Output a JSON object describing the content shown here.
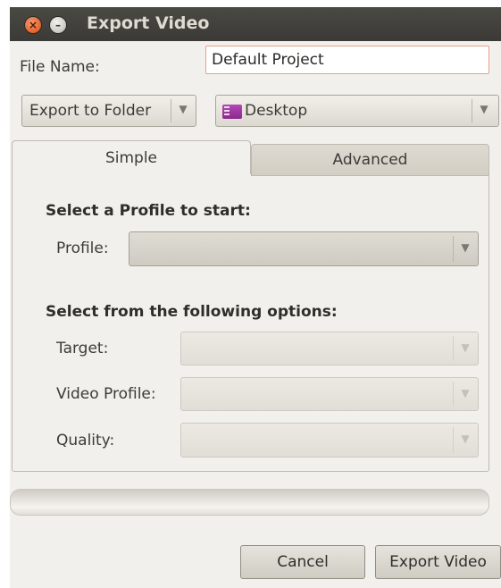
{
  "window": {
    "title": "Export Video"
  },
  "file_name": {
    "label": "File Name:",
    "value": "Default Project"
  },
  "export_mode": {
    "selected": "Export to Folder"
  },
  "folder": {
    "selected": "Desktop",
    "icon": "folder-icon",
    "icon_color": "#9b35a0"
  },
  "tabs": [
    {
      "label": "Simple",
      "active": true
    },
    {
      "label": "Advanced",
      "active": false
    }
  ],
  "simple": {
    "profile_heading": "Select a Profile to start:",
    "profile_label": "Profile:",
    "profile_value": "",
    "options_heading": "Select from the following options:",
    "target_label": "Target:",
    "target_value": "",
    "video_profile_label": "Video Profile:",
    "video_profile_value": "",
    "quality_label": "Quality:",
    "quality_value": ""
  },
  "progress": {
    "fraction": 0
  },
  "buttons": {
    "cancel": "Cancel",
    "export": "Export Video"
  },
  "colors": {
    "titlebar": "#3f3e3a",
    "close_button": "#e65a24",
    "entry_border": "#e8a088"
  }
}
